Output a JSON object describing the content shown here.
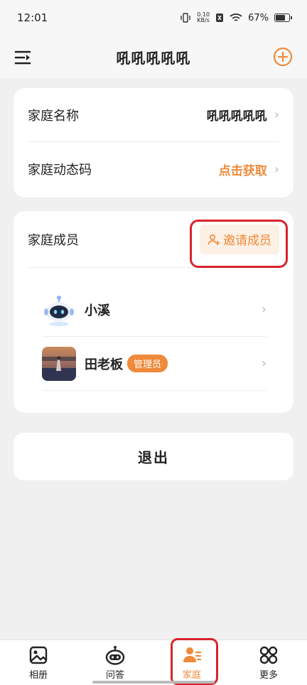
{
  "status_bar": {
    "time": "12:01",
    "net_speed_value": "0.10",
    "net_speed_unit": "KB/s",
    "battery": "67%"
  },
  "header": {
    "title": "吼吼吼吼吼"
  },
  "family_card": {
    "name_label": "家庭名称",
    "name_value": "吼吼吼吼吼",
    "code_label": "家庭动态码",
    "code_value": "点击获取"
  },
  "members_card": {
    "title": "家庭成员",
    "invite_label": "邀请成员",
    "members": [
      {
        "name": "小溪",
        "badge": ""
      },
      {
        "name": "田老板",
        "badge": "管理员"
      }
    ]
  },
  "logout_label": "退出",
  "tabs": [
    {
      "label": "相册",
      "icon": "album-icon",
      "active": false
    },
    {
      "label": "问答",
      "icon": "robot-icon",
      "active": false
    },
    {
      "label": "家庭",
      "icon": "family-icon",
      "active": true
    },
    {
      "label": "更多",
      "icon": "more-icon",
      "active": false
    }
  ],
  "colors": {
    "accent": "#ef8a3a",
    "highlight": "#d9232b",
    "background": "#f0f0f0"
  }
}
